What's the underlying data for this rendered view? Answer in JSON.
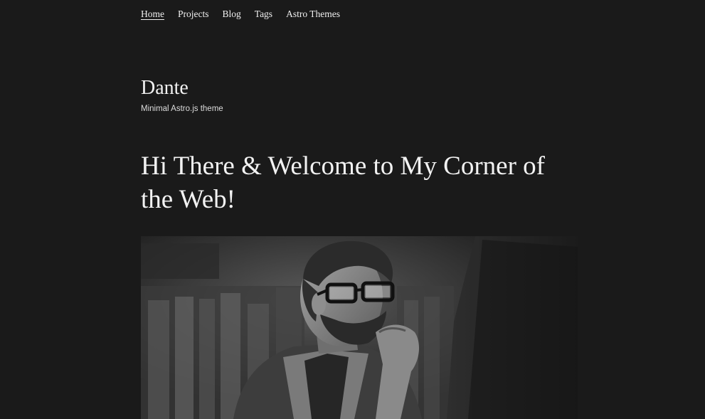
{
  "nav": {
    "items": [
      {
        "label": "Home",
        "active": true
      },
      {
        "label": "Projects",
        "active": false
      },
      {
        "label": "Blog",
        "active": false
      },
      {
        "label": "Tags",
        "active": false
      },
      {
        "label": "Astro Themes",
        "active": false
      }
    ]
  },
  "site": {
    "title": "Dante",
    "subtitle": "Minimal Astro.js theme"
  },
  "hero": {
    "heading": "Hi There & Welcome to My Corner of the Web!",
    "image": {
      "icon": "photo-man-with-glasses-at-computer",
      "style": "grayscale"
    }
  },
  "colors": {
    "background": "#1a1a1a",
    "text": "#f2f2f2"
  }
}
